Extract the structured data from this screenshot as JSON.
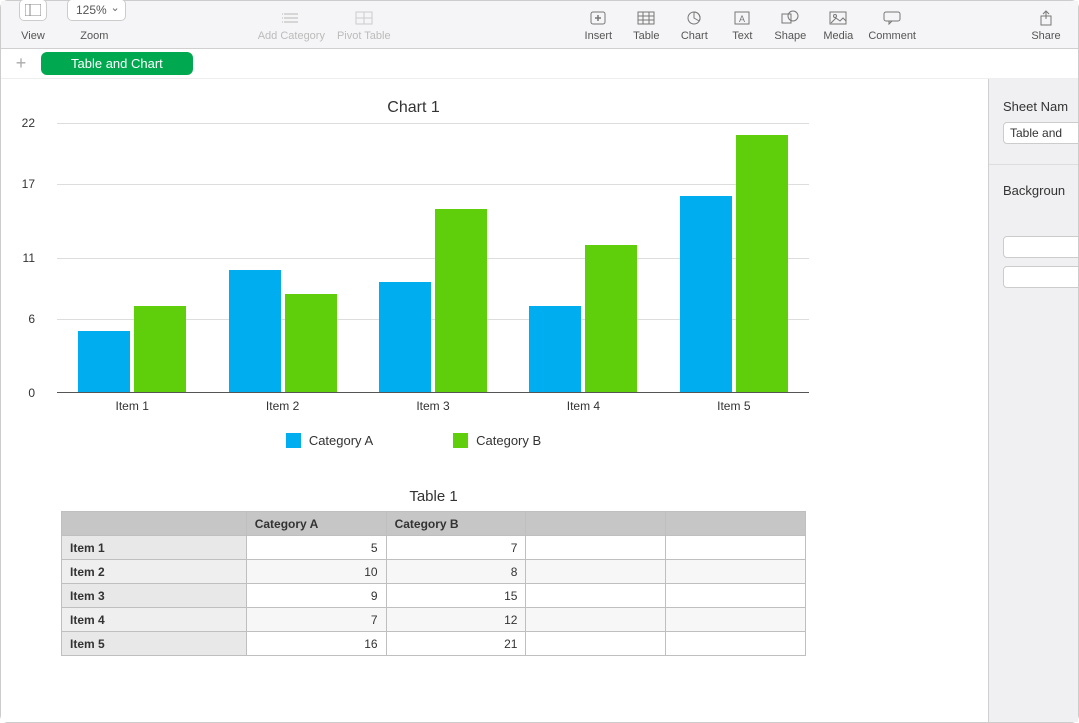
{
  "toolbar": {
    "view": "View",
    "zoom": "Zoom",
    "zoom_value": "125%",
    "add_category": "Add Category",
    "pivot_table": "Pivot Table",
    "insert": "Insert",
    "table": "Table",
    "chart": "Chart",
    "text": "Text",
    "shape": "Shape",
    "media": "Media",
    "comment": "Comment",
    "share": "Share"
  },
  "tabs": {
    "active": "Table and Chart"
  },
  "inspector": {
    "sheet_name_label": "Sheet Nam",
    "sheet_name_value": "Table and ",
    "background_label": "Backgroun"
  },
  "chart_data": {
    "type": "bar",
    "title": "Chart 1",
    "categories": [
      "Item 1",
      "Item 2",
      "Item 3",
      "Item 4",
      "Item 5"
    ],
    "series": [
      {
        "name": "Category A",
        "color": "#00aef0",
        "values": [
          5,
          10,
          9,
          7,
          16
        ]
      },
      {
        "name": "Category B",
        "color": "#5fce0b",
        "values": [
          7,
          8,
          15,
          12,
          21
        ]
      }
    ],
    "y_ticks": [
      0,
      6,
      11,
      17,
      22
    ],
    "ylim": [
      0,
      22
    ],
    "xlabel": "",
    "ylabel": ""
  },
  "table": {
    "title": "Table 1",
    "columns": [
      "Category A",
      "Category B"
    ],
    "rows": [
      {
        "label": "Item 1",
        "values": [
          "5",
          "7"
        ]
      },
      {
        "label": "Item 2",
        "values": [
          "10",
          "8"
        ]
      },
      {
        "label": "Item 3",
        "values": [
          "9",
          "15"
        ]
      },
      {
        "label": "Item 4",
        "values": [
          "7",
          "12"
        ]
      },
      {
        "label": "Item 5",
        "values": [
          "16",
          "21"
        ]
      }
    ]
  }
}
